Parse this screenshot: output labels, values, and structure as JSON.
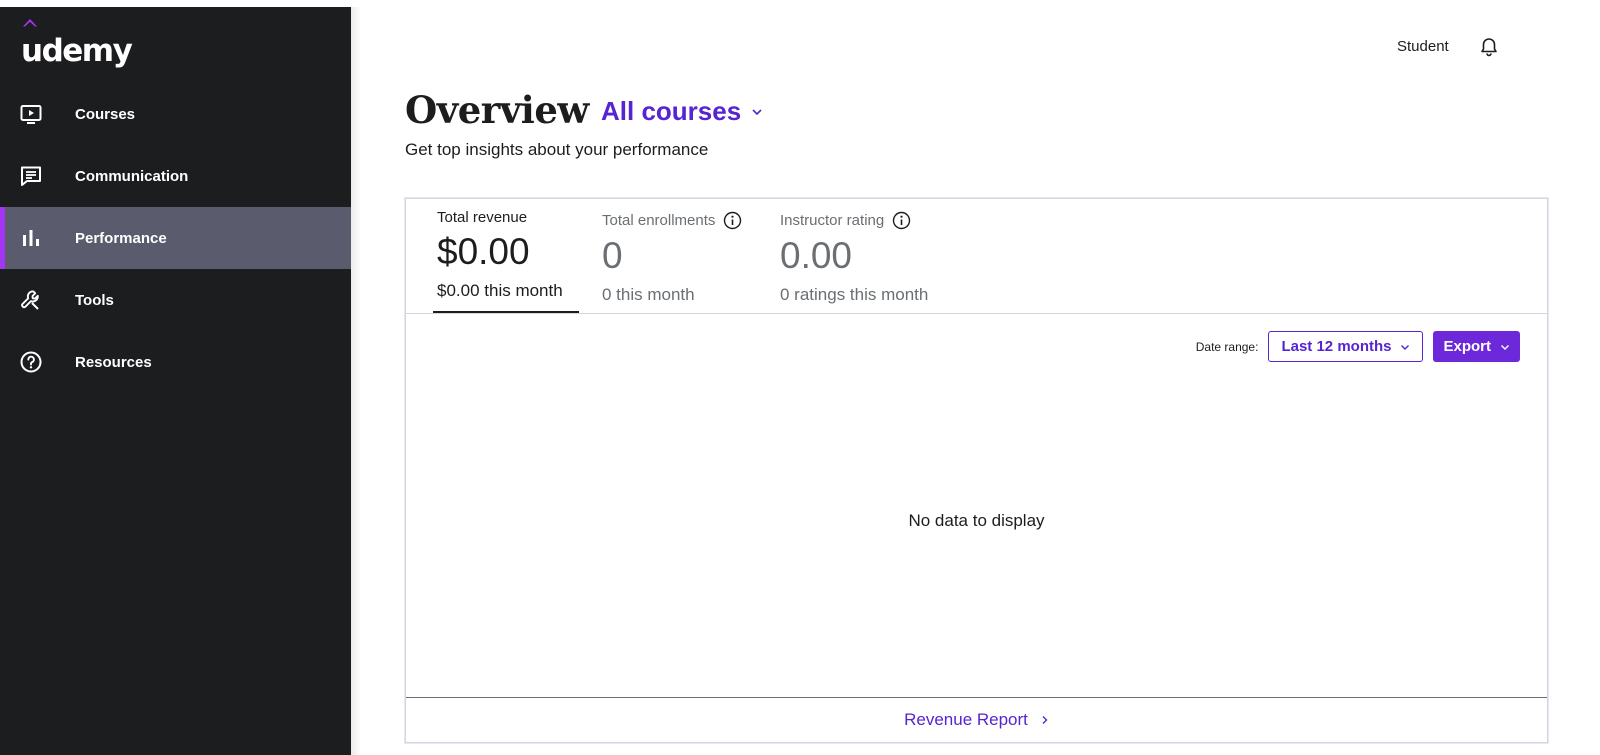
{
  "brand": {
    "logo_text": "udemy",
    "accent_color": "#a435f0",
    "link_color": "#5624d0"
  },
  "sidebar": {
    "items": [
      {
        "label": "Courses",
        "icon": "play-screen-icon",
        "active": false
      },
      {
        "label": "Communication",
        "icon": "message-icon",
        "active": false
      },
      {
        "label": "Performance",
        "icon": "bar-chart-icon",
        "active": true
      },
      {
        "label": "Tools",
        "icon": "wrench-icon",
        "active": false
      },
      {
        "label": "Resources",
        "icon": "help-circle-icon",
        "active": false
      }
    ]
  },
  "topbar": {
    "user_label": "Student",
    "bell_icon": "bell-icon"
  },
  "header": {
    "title": "Overview",
    "course_select": "All courses",
    "subtitle": "Get top insights about your performance"
  },
  "stats": [
    {
      "label": "Total revenue",
      "value": "$0.00",
      "sub": "$0.00 this month",
      "selected": true
    },
    {
      "label": "Total enrollments",
      "value": "0",
      "sub": "0 this month",
      "selected": false,
      "info_icon": "info-icon"
    },
    {
      "label": "Instructor rating",
      "value": "0.00",
      "sub": "0 ratings this month",
      "selected": false,
      "info_icon": "info-icon"
    }
  ],
  "controls": {
    "date_range_label": "Date range:",
    "date_range_value": "Last 12 months",
    "export_label": "Export"
  },
  "chart_area": {
    "empty_message": "No data to display"
  },
  "footer": {
    "report_link": "Revenue Report"
  }
}
